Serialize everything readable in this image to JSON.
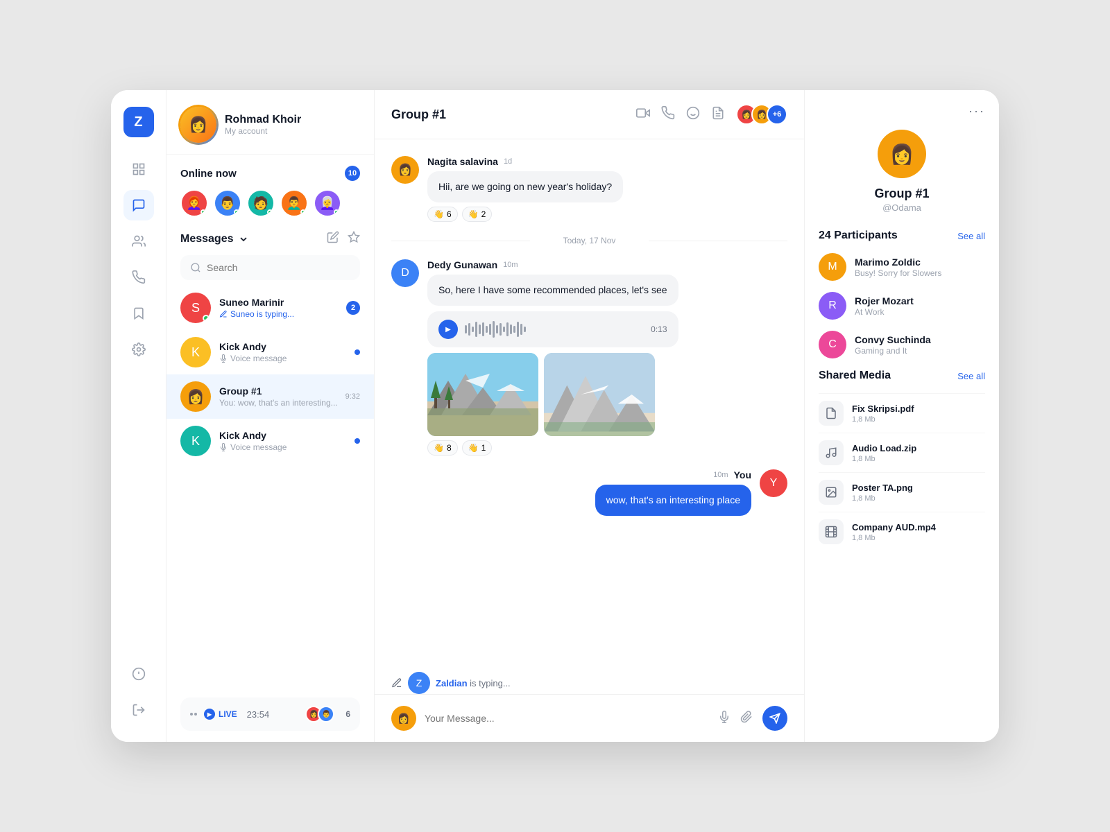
{
  "app": {
    "logo": "Z",
    "logoColor": "#2563eb"
  },
  "user": {
    "name": "Rohmad Khoir",
    "account": "My account",
    "avatarEmoji": "👩"
  },
  "online": {
    "label": "Online now",
    "count": 10,
    "avatars": [
      "👩‍🦰",
      "👨",
      "🧑‍🦱",
      "👨‍🦱",
      "👩‍🦳"
    ]
  },
  "messages": {
    "label": "Messages",
    "search_placeholder": "Search",
    "items": [
      {
        "name": "Suneo Marinir",
        "preview": "Suneo is typing...",
        "time": "",
        "badge": 2,
        "is_typing": true,
        "online": true
      },
      {
        "name": "Kick Andy",
        "preview": "Voice message",
        "time": "",
        "badge": 0,
        "unread_dot": true,
        "online": false
      },
      {
        "name": "Group #1",
        "preview": "You: wow, that's an interesting...",
        "time": "9:32",
        "badge": 0,
        "active": true,
        "online": false
      },
      {
        "name": "Kick Andy",
        "preview": "Voice message",
        "time": "",
        "badge": 0,
        "unread_dot": true,
        "online": false
      }
    ]
  },
  "live": {
    "time": "23:54",
    "count": 6
  },
  "chat": {
    "title": "Group #1",
    "participants_more": "+6",
    "messages": [
      {
        "sender": "Nagita salavina",
        "time": "1d",
        "own": false,
        "text": "Hii, are we going on new year's holiday?",
        "reactions": [
          {
            "emoji": "👋",
            "count": 6
          },
          {
            "emoji": "👋",
            "count": 2
          }
        ]
      },
      {
        "date_divider": "Today, 17 Nov"
      },
      {
        "sender": "Dedy Gunawan",
        "time": "10m",
        "own": false,
        "text": "So, here I have some recommended places, let's see",
        "has_voice": true,
        "voice_duration": "0:13",
        "has_images": true,
        "reactions": [
          {
            "emoji": "👋",
            "count": 8
          },
          {
            "emoji": "👋",
            "count": 1
          }
        ]
      },
      {
        "sender": "You",
        "time": "10m",
        "own": true,
        "text": "wow, that's an interesting place"
      }
    ],
    "typing": {
      "name": "Zaldian",
      "text": "is typing..."
    },
    "input_placeholder": "Your Message..."
  },
  "right_panel": {
    "group_name": "Group #1",
    "group_handle": "@Odama",
    "participants_label": "24 Participants",
    "participants_see_all": "See all",
    "participants": [
      {
        "name": "Marimo Zoldic",
        "status": "Busy! Sorry for Slowers"
      },
      {
        "name": "Rojer Mozart",
        "status": "At Work"
      },
      {
        "name": "Convy Suchinda",
        "status": "Gaming and It"
      }
    ],
    "shared_media_label": "Shared Media",
    "shared_media_see_all": "See all",
    "media_items": [
      {
        "name": "Fix Skripsi.pdf",
        "size": "1,8 Mb",
        "type": "doc"
      },
      {
        "name": "Audio Load.zip",
        "size": "1,8 Mb",
        "type": "audio"
      },
      {
        "name": "Poster TA.png",
        "size": "1,8 Mb",
        "type": "image"
      },
      {
        "name": "Company AUD.mp4",
        "size": "1,8 Mb",
        "type": "video"
      }
    ]
  },
  "nav": {
    "icons": [
      "⊞",
      "💬",
      "👥",
      "📞",
      "🔖",
      "⚙️",
      "ℹ️",
      "↪"
    ]
  }
}
